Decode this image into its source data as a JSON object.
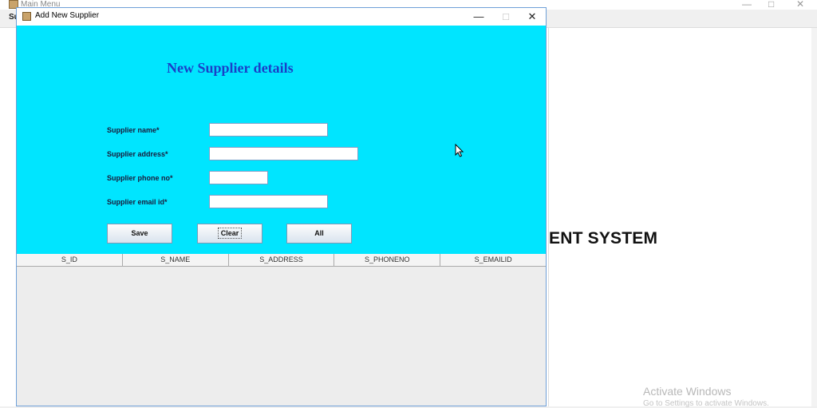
{
  "background_window": {
    "title": "Main Menu",
    "menu_label": "Su",
    "controls": {
      "minimize": "—",
      "maximize": "□",
      "close": "✕"
    },
    "heading": "ENT SYSTEM"
  },
  "dialog": {
    "title": "Add New Supplier",
    "controls": {
      "minimize": "—",
      "maximize": "□",
      "close": "✕"
    },
    "form_title": "New Supplier details",
    "fields": [
      {
        "label": "Supplier name*",
        "value": ""
      },
      {
        "label": "Supplier address*",
        "value": ""
      },
      {
        "label": "Supplier phone no*",
        "value": ""
      },
      {
        "label": "Supplier email id*",
        "value": ""
      }
    ],
    "buttons": {
      "save": "Save",
      "clear": "Clear",
      "all": "All"
    },
    "table": {
      "columns": [
        "S_ID",
        "S_NAME",
        "S_ADDRESS",
        "S_PHONENO",
        "S_EMAILID"
      ],
      "rows": []
    }
  },
  "watermark": {
    "line1": "Activate Windows",
    "line2": "Go to Settings to activate Windows."
  },
  "colors": {
    "form_bg": "#00e5ff",
    "form_title": "#1a40c8",
    "window_border": "#6fa0d8"
  }
}
